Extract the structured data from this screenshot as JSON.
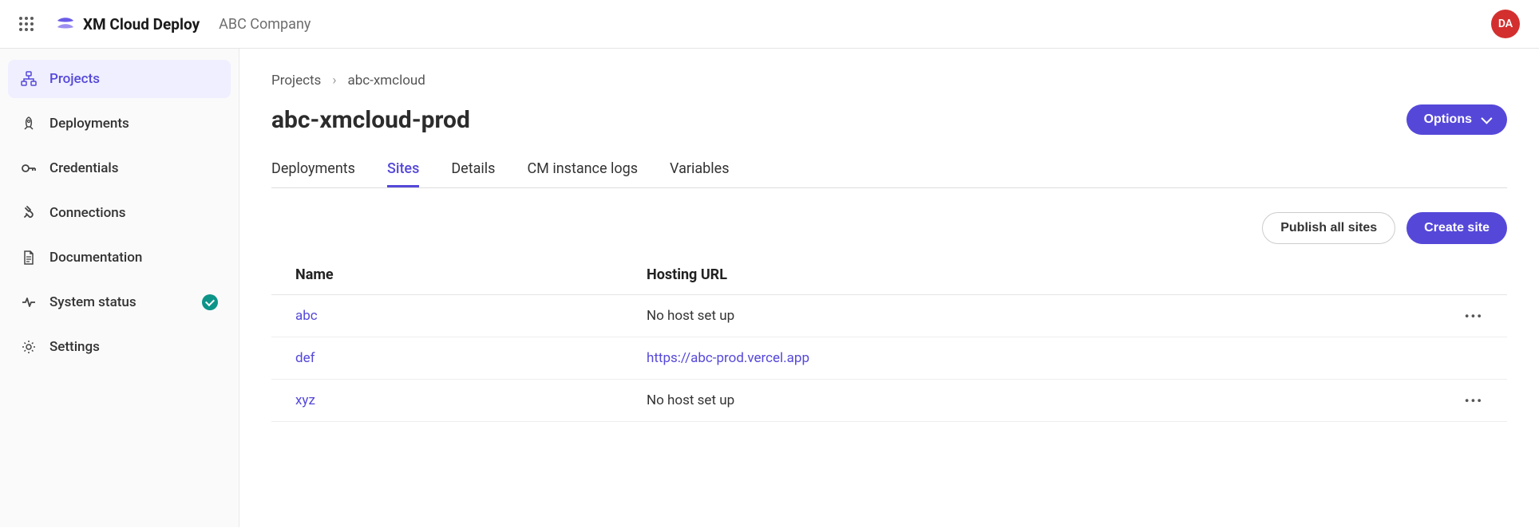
{
  "header": {
    "product_name": "XM Cloud Deploy",
    "company_name": "ABC Company",
    "avatar_initials": "DA"
  },
  "sidebar": {
    "items": [
      {
        "label": "Projects",
        "icon": "sitemap-icon",
        "active": true
      },
      {
        "label": "Deployments",
        "icon": "rocket-icon",
        "active": false
      },
      {
        "label": "Credentials",
        "icon": "key-icon",
        "active": false
      },
      {
        "label": "Connections",
        "icon": "plug-icon",
        "active": false
      },
      {
        "label": "Documentation",
        "icon": "document-icon",
        "active": false
      },
      {
        "label": "System status",
        "icon": "heartbeat-icon",
        "active": false,
        "status_ok": true
      },
      {
        "label": "Settings",
        "icon": "gear-icon",
        "active": false
      }
    ]
  },
  "breadcrumb": {
    "root": "Projects",
    "current": "abc-xmcloud"
  },
  "page": {
    "title": "abc-xmcloud-prod",
    "options_label": "Options",
    "tabs": [
      "Deployments",
      "Sites",
      "Details",
      "CM instance logs",
      "Variables"
    ],
    "active_tab": "Sites",
    "actions": {
      "publish_all": "Publish all sites",
      "create_site": "Create site"
    },
    "table": {
      "headers": {
        "name": "Name",
        "url": "Hosting URL"
      },
      "rows": [
        {
          "name": "abc",
          "url_text": "No host set up",
          "url_link": false,
          "menu": true
        },
        {
          "name": "def",
          "url_text": "https://abc-prod.vercel.app",
          "url_link": true,
          "menu": false
        },
        {
          "name": "xyz",
          "url_text": "No host set up",
          "url_link": false,
          "menu": true
        }
      ]
    }
  }
}
